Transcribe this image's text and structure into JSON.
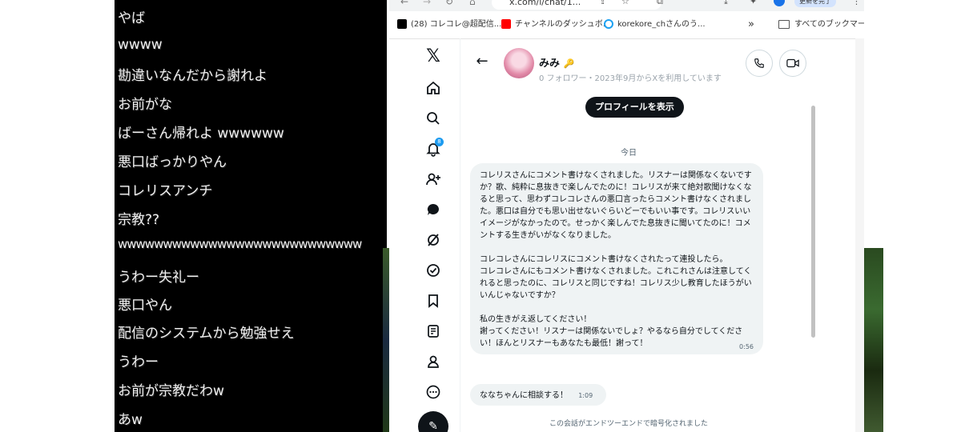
{
  "chat_lines": [
    "やば",
    "wwww",
    "勘違いなんだから謝れよ",
    "お前がな",
    "ばーさん帰れよ wwwwww",
    "悪口ばっかりやん",
    "コレリスアンチ",
    "宗教??",
    "wwwwwwwwwwwwwwwwwwwwwwwwwww",
    "うわー失礼ー",
    "悪口やん",
    "配信のシステムから勉強せえ",
    "うわー",
    "お前が宗教だわw",
    "あw"
  ],
  "browser": {
    "address": "x.com/i/chat/1...",
    "update_button": "更新を完了",
    "bookmarks": [
      {
        "label": "(28) コレコレ@超配信...",
        "color": "#000000"
      },
      {
        "label": "チャンネルのダッシュボ...",
        "color": "#ff0000"
      },
      {
        "label": "korekore_chさんのう...",
        "color": "#1da1f2"
      }
    ],
    "more": "»",
    "all_bookmarks": "すべてのブックマーク"
  },
  "sidebar": {
    "icons": [
      "x-logo-icon",
      "home-icon",
      "search-icon",
      "notifications-icon",
      "follow-icon",
      "messages-icon",
      "grok-icon",
      "communities-icon",
      "bookmarks-icon",
      "articles-icon",
      "profile-icon",
      "more-icon"
    ],
    "notification_count": "8",
    "compose": "compose-icon"
  },
  "conversation": {
    "name": "みみ",
    "key_badge": "🔑",
    "meta": "0 フォロワー・2023年9月からXを利用しています",
    "view_profile": "プロフィールを表示",
    "day": "今日",
    "messages": [
      {
        "paragraphs": [
          "コレリスさんにコメント書けなくされました。リスナーは関係なくないですか？歌、純粋に息抜きで楽しんでたのに！コレリスが来て絶対歌聞けなくなると思って、思わずコレコレさんの悪口言ったらコメント書けなくされました。悪口は自分でも思い出せないぐらいどーでもいい事です。コレリスいいイメージがなかったので。せっかく楽しんでた息抜きに聞いてたのに！コメントする生きがいがなくなりました。",
          "コレコレさんにコレリスにコメント書けなくされたって連投したら。\nコレコレさんにもコメント書けなくされました。これこれさんは注意してくれると思ったのに、コレリスと同じですね！コレリス少し教育したほうがいいんじゃないですか？",
          "私の生きがえ返してください！\n謝ってください！リスナーは関係ないでしょ？やるなら自分でしてください！ほんとリスナーもあなたも最低！謝って！"
        ],
        "time": "0:56"
      },
      {
        "paragraphs": [
          "ななちゃんに相談する！"
        ],
        "time": "1:09"
      }
    ],
    "footer": "この会話がエンドツーエンドで暗号化されました"
  },
  "colors": {
    "chat_bg": "#000000",
    "bubble": "#eff3f4",
    "notification": "#1d9bf0",
    "accent": "#0f1419"
  }
}
